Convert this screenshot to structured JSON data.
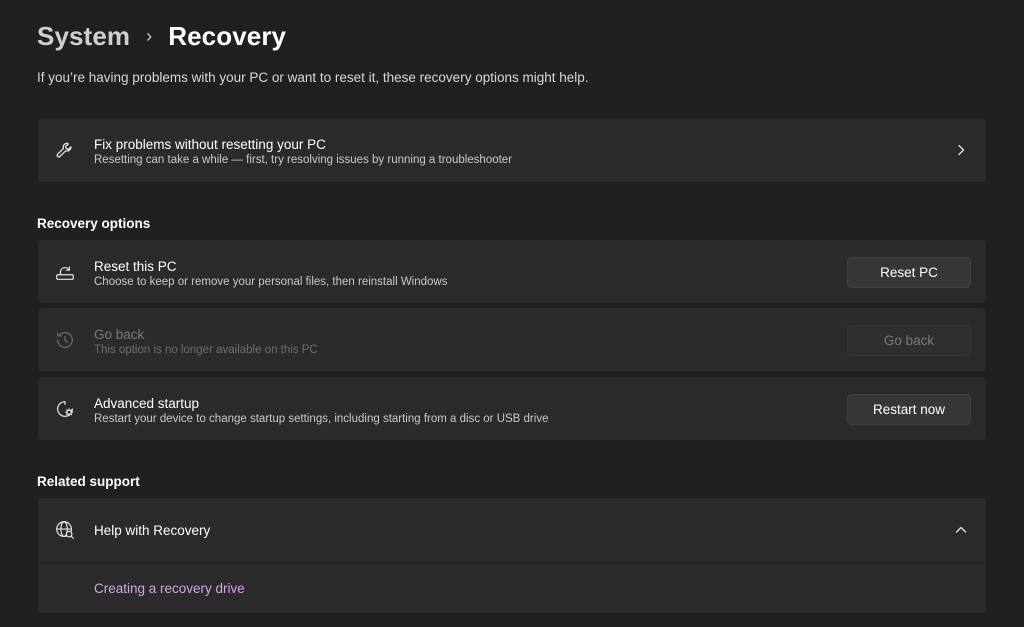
{
  "breadcrumb": {
    "parent": "System",
    "separator": "›",
    "current": "Recovery"
  },
  "subtitle": "If you’re having problems with your PC or want to reset it, these recovery options might help.",
  "fix_card": {
    "icon": "wrench-icon",
    "title": "Fix problems without resetting your PC",
    "description": "Resetting can take a while — first, try resolving issues by running a troubleshooter"
  },
  "recovery_options": {
    "heading": "Recovery options",
    "items": [
      {
        "icon": "reset-pc-icon",
        "title": "Reset this PC",
        "description": "Choose to keep or remove your personal files, then reinstall Windows",
        "button": "Reset PC",
        "enabled": true
      },
      {
        "icon": "history-icon",
        "title": "Go back",
        "description": "This option is no longer available on this PC",
        "button": "Go back",
        "enabled": false
      },
      {
        "icon": "advanced-startup-icon",
        "title": "Advanced startup",
        "description": "Restart your device to change startup settings, including starting from a disc or USB drive",
        "button": "Restart now",
        "enabled": true
      }
    ]
  },
  "related_support": {
    "heading": "Related support",
    "help_title": "Help with Recovery",
    "help_icon": "globe-search-icon",
    "expanded": true,
    "links": [
      "Creating a recovery drive"
    ]
  },
  "colors": {
    "background": "#202020",
    "card": "#2b2b2b",
    "link": "#d4a5e6",
    "disabled_text": "#7a7a7a"
  }
}
